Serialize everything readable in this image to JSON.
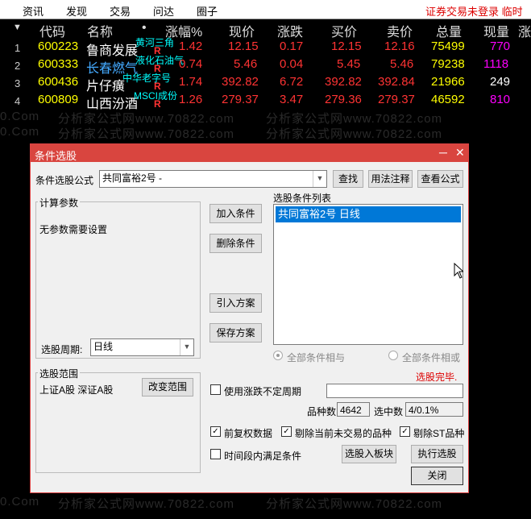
{
  "menu": {
    "items": [
      "资讯",
      "发现",
      "交易",
      "问达",
      "圈子"
    ],
    "status": "证券交易未登录  临时"
  },
  "table": {
    "headers": {
      "code": "代码",
      "name": "名称",
      "dot": "•",
      "pct": "涨幅%",
      "price": "现价",
      "chg": "涨跌",
      "bid": "买价",
      "ask": "卖价",
      "vol": "总量",
      "cur": "现量",
      "extra": "涨"
    },
    "marker": "▼",
    "rows": [
      {
        "n": "1",
        "code": "600223",
        "name": "鲁商发展",
        "tag": "黄河三角",
        "r": "R",
        "pct": "1.42",
        "price": "12.15",
        "chg": "0.17",
        "bid": "12.15",
        "ask": "12.16",
        "vol": "75499",
        "cur": "770"
      },
      {
        "n": "2",
        "code": "600333",
        "name": "长春燃气",
        "tag": "液化石油气",
        "r": "R",
        "pct": "0.74",
        "price": "5.46",
        "chg": "0.04",
        "bid": "5.45",
        "ask": "5.46",
        "vol": "79238",
        "cur": "1118"
      },
      {
        "n": "3",
        "code": "600436",
        "name": "片仔癀",
        "tag": "中华老字号",
        "r": "R",
        "pct": "1.74",
        "price": "392.82",
        "chg": "6.72",
        "bid": "392.82",
        "ask": "392.84",
        "vol": "21966",
        "cur": "249"
      },
      {
        "n": "4",
        "code": "600809",
        "name": "山西汾酒",
        "tag": "MSCI成份",
        "r": "R",
        "pct": "1.26",
        "price": "279.37",
        "chg": "3.47",
        "bid": "279.36",
        "ask": "279.37",
        "vol": "46592",
        "cur": "810"
      }
    ]
  },
  "watermark": "分析家公式网www.70822.com",
  "watermark_short": "0.Com",
  "dialog": {
    "title": "条件选股",
    "min": "─",
    "close": "✕",
    "formula_label": "条件选股公式",
    "formula_value": "共同富裕2号  -",
    "btn_find": "查找",
    "btn_usage": "用法注释",
    "btn_view": "查看公式",
    "calc_group": "计算参数",
    "no_param": "无参数需要设置",
    "period_label": "选股周期:",
    "period_value": "日线",
    "btn_add": "加入条件",
    "btn_delete": "删除条件",
    "btn_import": "引入方案",
    "btn_save": "保存方案",
    "list_title": "选股条件列表",
    "list_item": "共同富裕2号  日线",
    "radio_and": "全部条件相与",
    "radio_or": "全部条件相或",
    "done": "选股完毕.",
    "range_group": "选股范围",
    "range_value": "上证A股 深证A股",
    "btn_range": "改变范围",
    "use_period": "使用涨跌不定周期",
    "count_label": "品种数",
    "count_value": "4642",
    "selected_label": "选中数",
    "selected_value": "4/0.1%",
    "chk_prefix": "前复权数据",
    "chk_exclude_untraded": "剔除当前未交易的品种",
    "chk_exclude_st": "剔除ST品种",
    "chk_timeseg": "时间段内满足条件",
    "btn_to_board": "选股入板块",
    "btn_run": "执行选股",
    "btn_close": "关闭",
    "check_mark": "✓"
  }
}
